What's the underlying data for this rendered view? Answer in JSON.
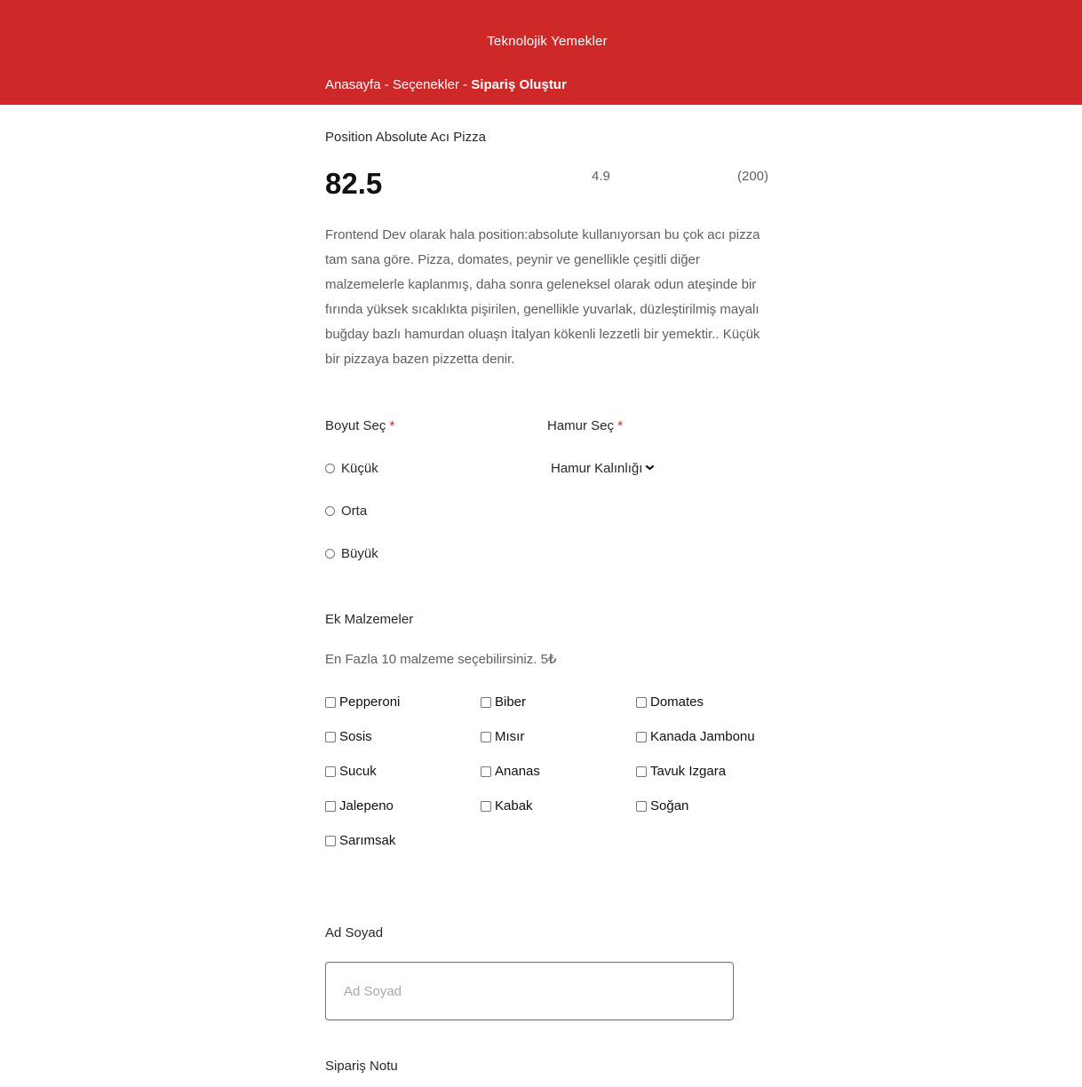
{
  "header": {
    "brand": "Teknolojik Yemekler",
    "breadcrumb": {
      "home": "Anasayfa",
      "sep1": " - ",
      "options": "Seçenekler",
      "sep2": " - ",
      "current": "Sipariş Oluştur"
    }
  },
  "product": {
    "name": "Position Absolute Acı Pizza",
    "price": "82.5",
    "rating": "4.9",
    "reviews": "(200)",
    "description": "Frontend Dev olarak hala position:absolute kullanıyorsan bu çok acı pizza tam sana göre. Pizza, domates, peynir ve genellikle çeşitli diğer malzemelerle kaplanmış, daha sonra geleneksel olarak odun ateşinde bir fırında yüksek sıcaklıkta pişirilen, genellikle yuvarlak, düzleştirilmiş mayalı buğday bazlı hamurdan oluaşn İtalyan kökenli lezzetli bir yemektir.. Küçük bir pizzaya bazen pizzetta denir."
  },
  "size": {
    "label": "Boyut Seç",
    "required_mark": "*",
    "options": [
      "Küçük",
      "Orta",
      "Büyük"
    ]
  },
  "dough": {
    "label": "Hamur Seç",
    "required_mark": "*",
    "selected": "Hamur Kalınlığı",
    "icon": "chevron-down-icon"
  },
  "extras": {
    "title": "Ek Malzemeler",
    "subtitle": "En Fazla 10 malzeme seçebilirsiniz. 5₺",
    "items": [
      "Pepperoni",
      "Biber",
      "Domates",
      "Sosis",
      "Mısır",
      "Kanada Jambonu",
      "Sucuk",
      "Ananas",
      "Tavuk Izgara",
      "Jalepeno",
      "Kabak",
      "Soğan",
      "Sarımsak"
    ]
  },
  "name_field": {
    "label": "Ad Soyad",
    "placeholder": "Ad Soyad"
  },
  "note_field": {
    "label": "Sipariş Notu"
  },
  "colors": {
    "brand_red": "#ce2829",
    "text_dark": "#292929",
    "text_muted": "#5f5f5f"
  }
}
